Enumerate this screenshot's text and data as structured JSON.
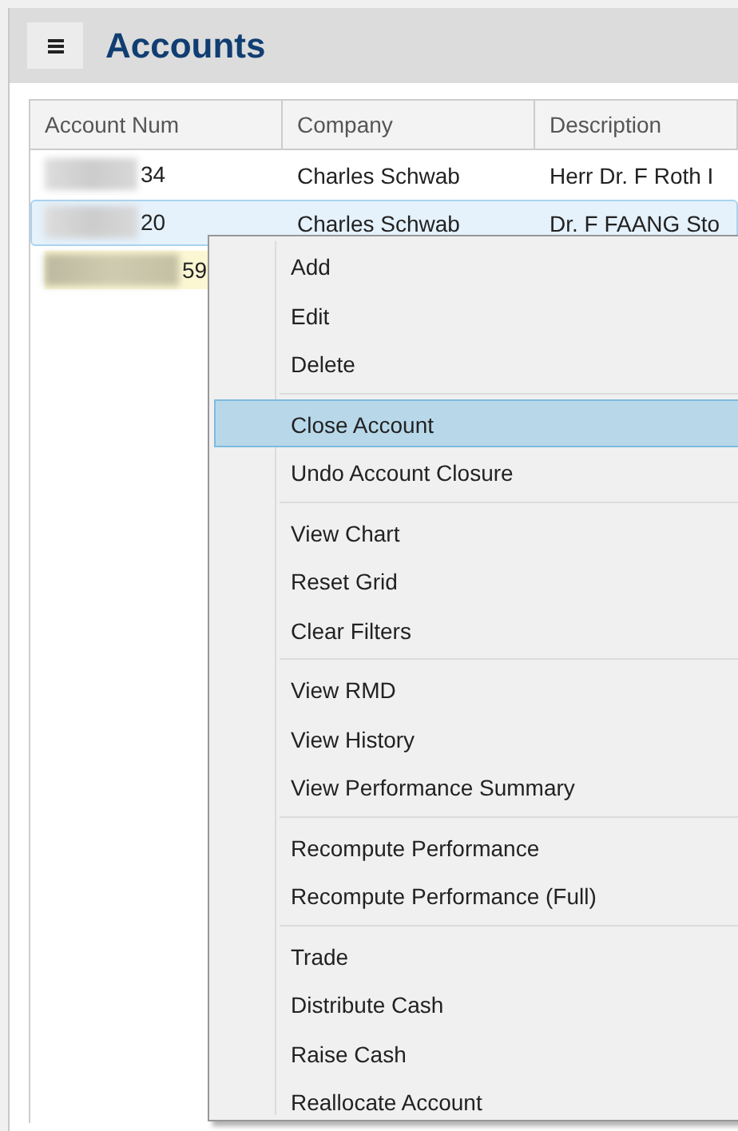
{
  "header": {
    "title": "Accounts"
  },
  "table": {
    "columns": [
      "Account Num",
      "Company",
      "Description"
    ],
    "rows": [
      {
        "account_num": "34",
        "company": "Charles Schwab",
        "description": "Herr Dr. F Roth I",
        "selected": false,
        "flagged": false
      },
      {
        "account_num": "20",
        "company": "Charles Schwab",
        "description": "Dr. F FAANG Sto",
        "selected": true,
        "flagged": false
      },
      {
        "account_num": "59",
        "selected": false,
        "flagged": true
      }
    ]
  },
  "context_menu": {
    "groups": [
      {
        "items": [
          {
            "label": "Add",
            "selected": false
          },
          {
            "label": "Edit",
            "selected": false
          },
          {
            "label": "Delete",
            "selected": false
          }
        ]
      },
      {
        "items": [
          {
            "label": "Close Account",
            "selected": true
          },
          {
            "label": "Undo Account Closure",
            "selected": false
          }
        ]
      },
      {
        "items": [
          {
            "label": "View Chart",
            "selected": false
          },
          {
            "label": "Reset Grid",
            "selected": false
          },
          {
            "label": "Clear Filters",
            "selected": false
          }
        ]
      },
      {
        "items": [
          {
            "label": "View RMD",
            "selected": false
          },
          {
            "label": "View History",
            "selected": false
          },
          {
            "label": "View Performance Summary",
            "selected": false
          }
        ]
      },
      {
        "items": [
          {
            "label": "Recompute Performance",
            "selected": false
          },
          {
            "label": "Recompute Performance (Full)",
            "selected": false
          }
        ]
      },
      {
        "items": [
          {
            "label": "Trade",
            "selected": false
          },
          {
            "label": "Distribute Cash",
            "selected": false
          },
          {
            "label": "Raise Cash",
            "selected": false
          },
          {
            "label": "Reallocate Account",
            "selected": false
          }
        ]
      }
    ]
  }
}
